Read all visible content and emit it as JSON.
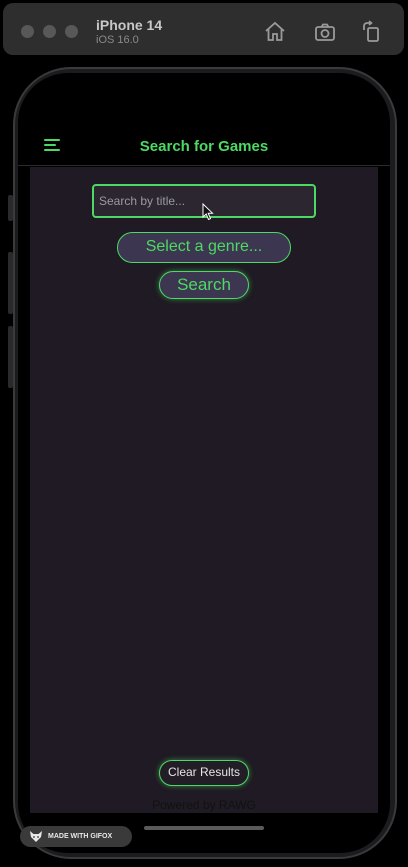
{
  "simulator": {
    "device_name": "iPhone 14",
    "os_version": "iOS 16.0",
    "icons": [
      "home-icon",
      "screenshot-icon",
      "rotate-icon"
    ]
  },
  "app": {
    "nav_title": "Search for Games",
    "search": {
      "placeholder": "Search by title...",
      "value": ""
    },
    "genre_select_label": "Select a genre...",
    "search_button_label": "Search",
    "clear_results_label": "Clear Results",
    "footer_text": "Powered by RAWG"
  },
  "watermark": {
    "text": "MADE WITH GIFOX"
  },
  "colors": {
    "accent": "#4cd964",
    "content_background": "#1f1a23",
    "pill_background": "#3d3650"
  }
}
